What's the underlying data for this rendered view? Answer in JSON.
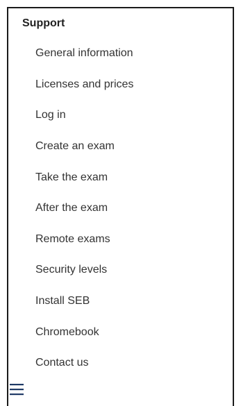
{
  "sidebar": {
    "title": "Support",
    "items": [
      {
        "label": "General information"
      },
      {
        "label": "Licenses and prices"
      },
      {
        "label": "Log in"
      },
      {
        "label": "Create an exam"
      },
      {
        "label": "Take the exam"
      },
      {
        "label": "After the exam"
      },
      {
        "label": "Remote exams"
      },
      {
        "label": "Security levels"
      },
      {
        "label": "Install SEB"
      },
      {
        "label": "Chromebook"
      },
      {
        "label": "Contact us"
      }
    ]
  },
  "menu_toggle": {
    "icon": "hamburger-menu-icon",
    "color": "#1f3a66"
  }
}
